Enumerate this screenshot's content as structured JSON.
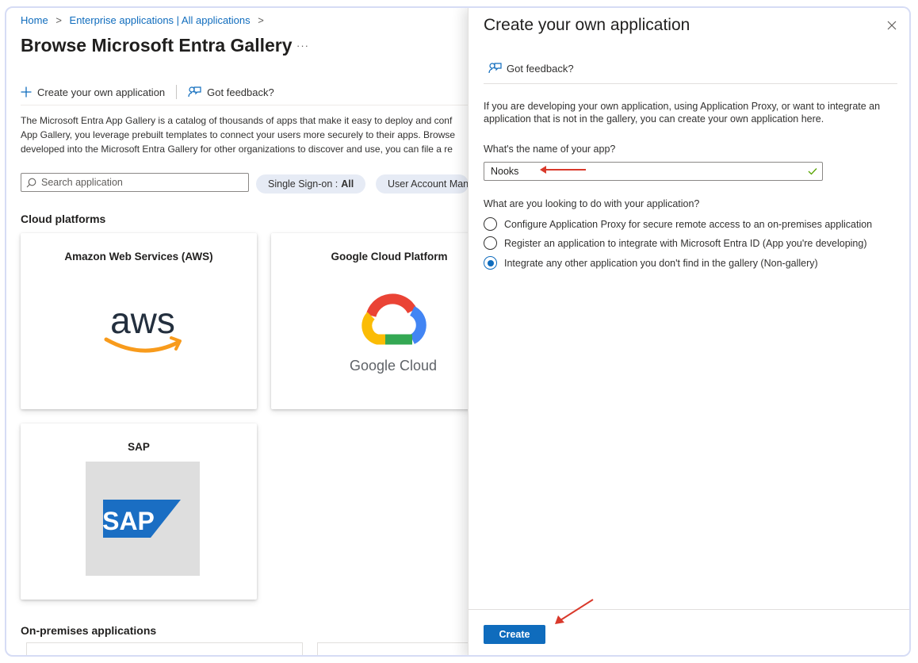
{
  "breadcrumb": {
    "home": "Home",
    "separator": ">",
    "enterprise": "Enterprise applications | All applications"
  },
  "page": {
    "title": "Browse Microsoft Entra Gallery",
    "more": "···",
    "commands": {
      "create_label": "Create your own application",
      "feedback_label": "Got feedback?"
    },
    "description_lines": [
      "The Microsoft Entra App Gallery is a catalog of thousands of apps that make it easy to deploy and conf",
      "App Gallery, you leverage prebuilt templates to connect your users more securely to their apps. Browse",
      "developed into the Microsoft Entra Gallery for other organizations to discover and use, you can file a re"
    ],
    "search": {
      "placeholder": "Search application"
    },
    "filters": [
      {
        "label": "Single Sign-on :",
        "value": "All"
      },
      {
        "label": "User Account Man",
        "value": ""
      }
    ],
    "sections": {
      "cloud": "Cloud platforms",
      "onprem": "On-premises applications"
    },
    "tiles": [
      {
        "name": "Amazon Web Services (AWS)",
        "logo_text": "aws"
      },
      {
        "name": "Google Cloud Platform",
        "logo_text": "Google Cloud"
      },
      {
        "name": "SAP",
        "logo_text": "SAP"
      }
    ]
  },
  "panel": {
    "title": "Create your own application",
    "feedback": "Got feedback?",
    "intro_lines": [
      "If you are developing your own application, using Application Proxy, or want to integrate an",
      "application that is not in the gallery, you can create your own application here."
    ],
    "name_label": "What's the name of your app?",
    "name_value": "Nooks",
    "question": "What are you looking to do with your application?",
    "options": [
      {
        "label": "Configure Application Proxy for secure remote access to an on-premises application",
        "selected": false
      },
      {
        "label": "Register an application to integrate with Microsoft Entra ID (App you're developing)",
        "selected": false
      },
      {
        "label": "Integrate any other application you don't find in the gallery (Non-gallery)",
        "selected": true
      }
    ],
    "create_label": "Create"
  },
  "colors": {
    "accent": "#0f6cbd",
    "annotation": "#d9392b",
    "aws_orange": "#f89b1c",
    "sap_blue": "#1a6ec3",
    "valid_green": "#57a300"
  },
  "icons": [
    "plus-icon",
    "feedback-icon",
    "search-icon",
    "close-icon",
    "checkmark-icon",
    "ellipsis-icon",
    "chevron-right-icon"
  ]
}
